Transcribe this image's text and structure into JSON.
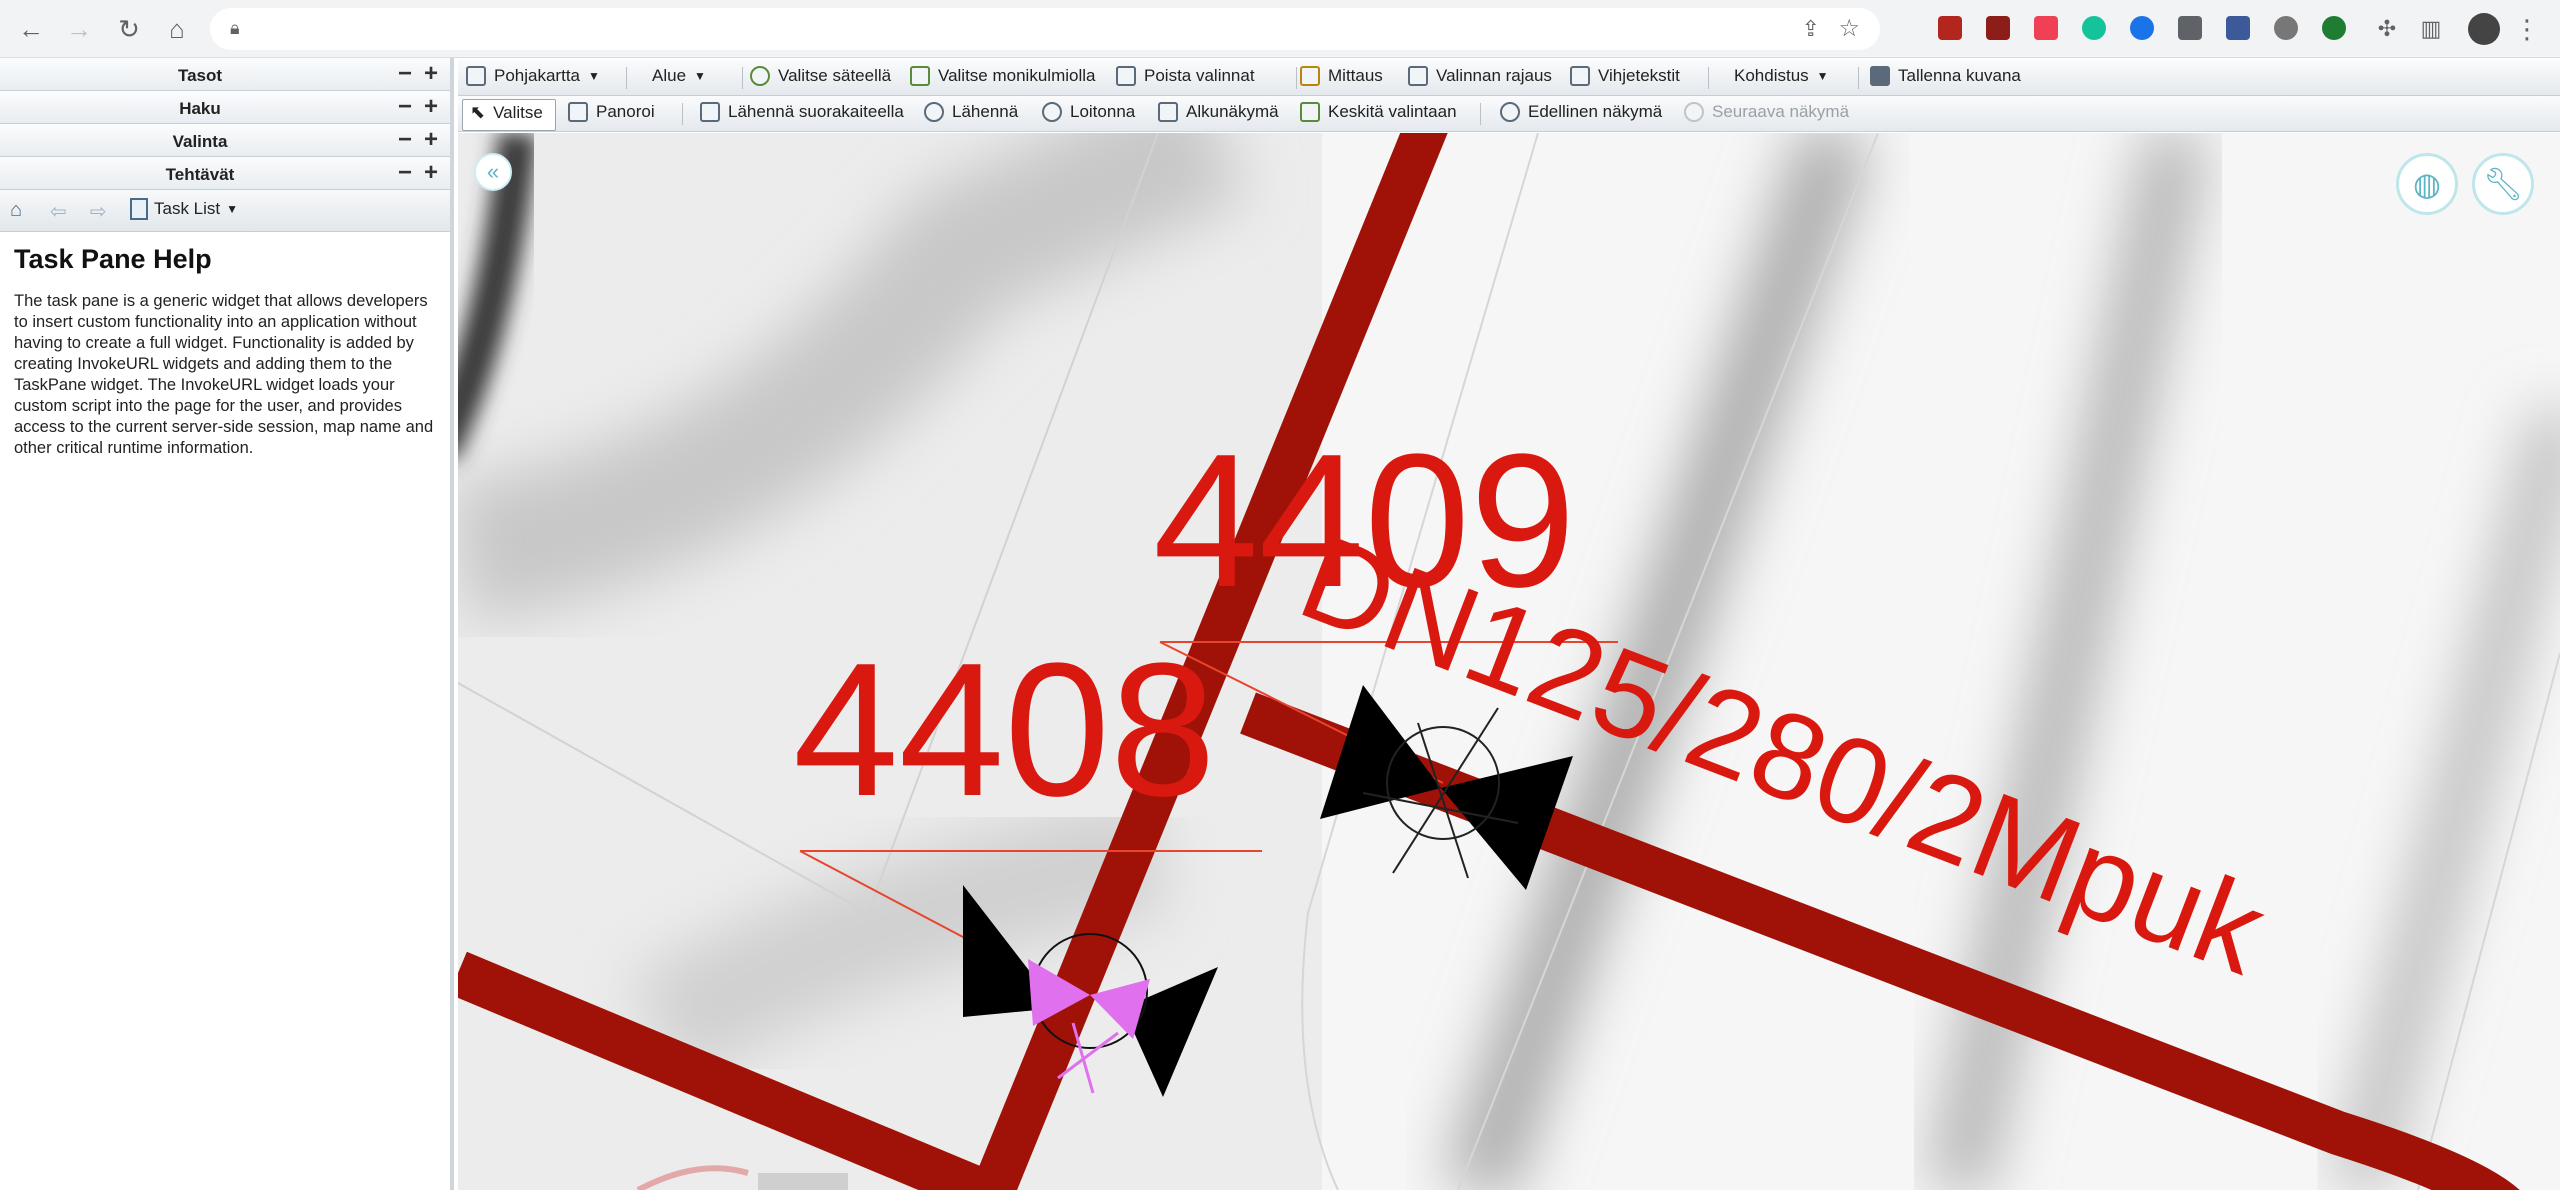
{
  "left_pane": {
    "sections": [
      {
        "label": "Tasot",
        "minus": "−",
        "plus": "+"
      },
      {
        "label": "Haku",
        "minus": "−",
        "plus": "+"
      },
      {
        "label": "Valinta",
        "minus": "−",
        "plus": "+"
      },
      {
        "label": "Tehtävät",
        "minus": "−",
        "plus": "+"
      }
    ],
    "task_list_label": "Task List",
    "help_title": "Task Pane Help",
    "help_text": "The task pane is a generic widget that allows developers to insert custom functionality into an application without having to create a full widget. Functionality is added by creating InvokeURL widgets and adding them to the TaskPane widget. The InvokeURL widget loads your custom script into the page for the user, and provides access to the current server-side session, map name and other critical runtime information."
  },
  "toolbar1": {
    "pohjakartta": "Pohjakartta",
    "alue": "Alue",
    "valitse_sateella": "Valitse säteellä",
    "valitse_monikulmiolla": "Valitse monikulmiolla",
    "poista_valinnat": "Poista valinnat",
    "mittaus": "Mittaus",
    "valinnan_rajaus": "Valinnan rajaus",
    "vihjetekstit": "Vihjetekstit",
    "kohdistus": "Kohdistus",
    "tallenna_kuvana": "Tallenna kuvana"
  },
  "toolbar2": {
    "valitse": "Valitse",
    "panoroi": "Panoroi",
    "lahenna_suorakaiteella": "Lähennä suorakaiteella",
    "lahenna": "Lähennä",
    "loitonna": "Loitonna",
    "alkunakyma": "Alkunäkymä",
    "keskita_valintaan": "Keskitä valintaan",
    "edellinen_nakyma": "Edellinen näkymä",
    "seuraava_nakyma": "Seuraava näkymä"
  },
  "map": {
    "label_4409": "4409",
    "label_4408": "4408",
    "pipe_label": "DN125/280/2Mpuk",
    "collapse_symbol": "«",
    "pipe_color": "#a01208",
    "label_color": "#d9190f",
    "valve_selected_color": "#e070ee"
  },
  "icons": {
    "back": "back-arrow-icon",
    "forward": "forward-arrow-icon",
    "reload": "reload-icon",
    "home": "home-icon",
    "globe": "globe-icon",
    "wrench": "wrench-icon"
  }
}
